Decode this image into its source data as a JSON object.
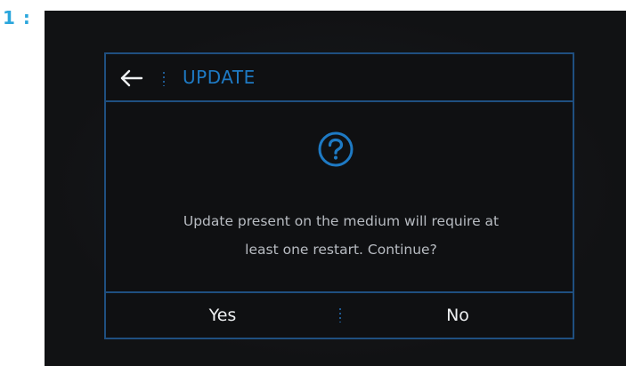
{
  "step": {
    "label": "1 :"
  },
  "dialog": {
    "title": "UPDATE",
    "back_icon": "arrow-left-icon",
    "prompt_icon": "question-circle-icon",
    "message": "Update  present on the medium will require at\nleast one restart. Continue?",
    "buttons": {
      "yes": "Yes",
      "no": "No"
    }
  },
  "colors": {
    "accent": "#1e7ac4",
    "border": "#1f4f80",
    "background": "#111214",
    "text": "#b8bcc2",
    "button_text": "#eef0f2",
    "step_label": "#2aa6dc"
  }
}
